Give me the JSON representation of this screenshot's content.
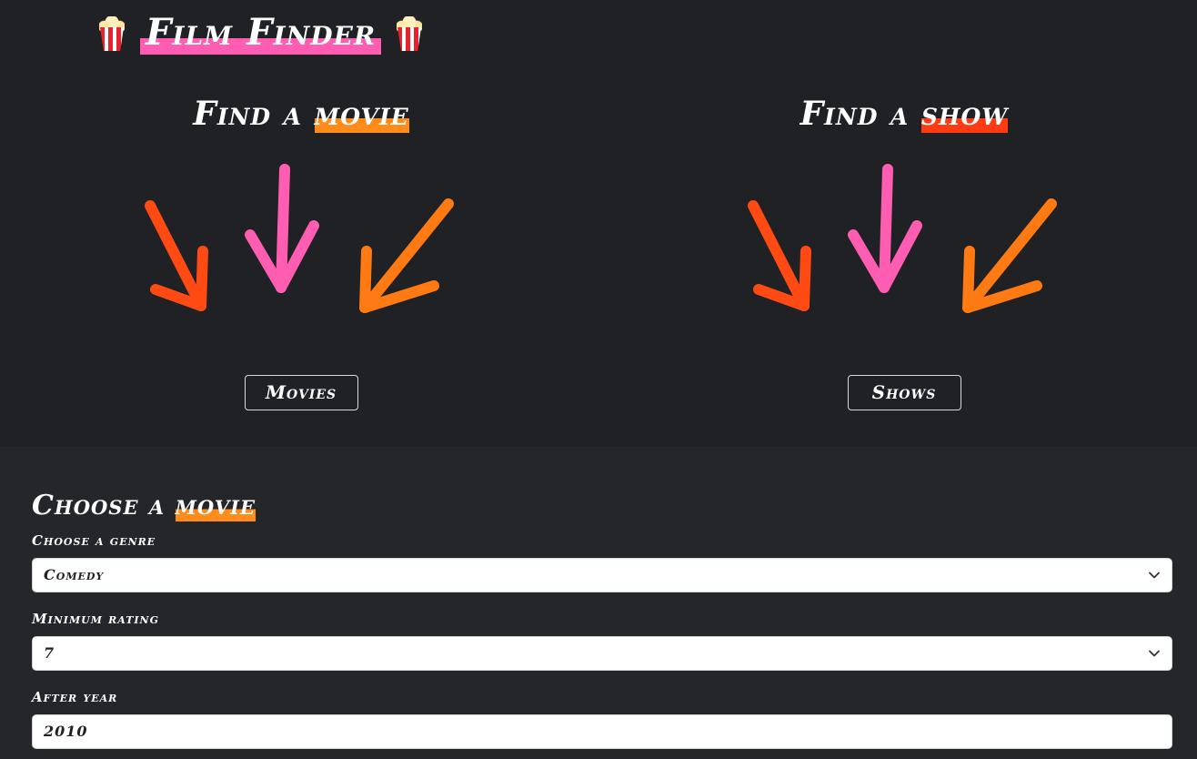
{
  "header": {
    "title": "Film Finder",
    "left_icon": "popcorn-icon",
    "right_icon": "popcorn-icon"
  },
  "movies_panel": {
    "heading_prefix": "Find a",
    "heading_highlight": "movie",
    "button_label": "Movies"
  },
  "shows_panel": {
    "heading_prefix": "Find a",
    "heading_highlight": "show",
    "button_label": "Shows"
  },
  "form": {
    "heading_prefix": "Choose a",
    "heading_highlight": "movie",
    "genre_label": "Choose a genre",
    "genre_value": "Comedy",
    "rating_label": "Minimum rating",
    "rating_value": "7",
    "year_label": "After year",
    "year_value": "2010"
  },
  "colors": {
    "page_bg": "#1f2125",
    "form_bg": "#25262a",
    "pink": "#ff5db1",
    "orange": "#ff8c1a",
    "red_orange": "#ff4a14"
  }
}
